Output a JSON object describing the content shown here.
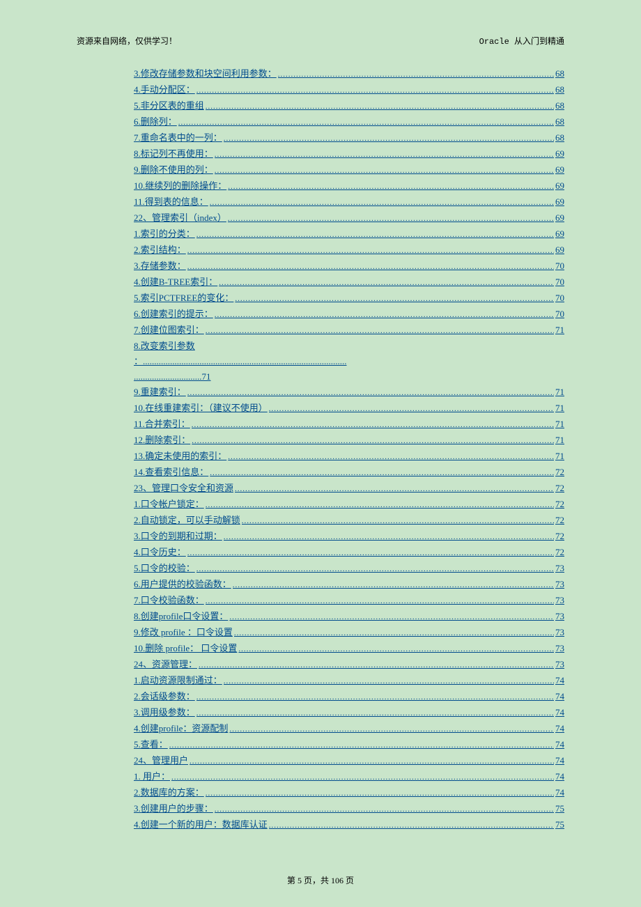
{
  "header": {
    "left": "资源来自网络，仅供学习！",
    "right": "Oracle 从入门到精通"
  },
  "toc": [
    {
      "label": "3.修改存储参数和块空间利用参数：",
      "page": "68"
    },
    {
      "label": "4.手动分配区：",
      "page": "68"
    },
    {
      "label": "5.非分区表的重组",
      "page": "68"
    },
    {
      "label": "6.删除列：",
      "page": "68"
    },
    {
      "label": "7.重命名表中的一列：",
      "page": "68"
    },
    {
      "label": "8.标记列不再使用：",
      "page": "69"
    },
    {
      "label": "9.删除不使用的列：",
      "page": "69"
    },
    {
      "label": "10.继续列的删除操作：",
      "page": "69"
    },
    {
      "label": "11.得到表的信息：",
      "page": "69"
    },
    {
      "label": "22、管理索引（index）",
      "page": "69",
      "section": true
    },
    {
      "label": "1.索引的分类：",
      "page": "69"
    },
    {
      "label": "2.索引结构：",
      "page": "69"
    },
    {
      "label": "3.存储参数：",
      "page": "70"
    },
    {
      "label": "4.创建B-TREE索引：",
      "page": "70"
    },
    {
      "label": "5.索引PCTFREE的变化：",
      "page": "70"
    },
    {
      "label": "6.创建索引的提示：",
      "page": "70"
    },
    {
      "label": "7.创建位图索引：",
      "page": "71"
    },
    {
      "label": "8.改变索引参数",
      "page": "71",
      "multiline": true
    },
    {
      "label": "9.重建索引：",
      "page": "71"
    },
    {
      "label": "10.在线重建索引：（建议不使用）",
      "page": "71"
    },
    {
      "label": "11.合并索引：",
      "page": "71"
    },
    {
      "label": "12.删除索引：",
      "page": "71"
    },
    {
      "label": "13.确定未使用的索引：",
      "page": "71"
    },
    {
      "label": "14.查看索引信息：",
      "page": "72"
    },
    {
      "label": "23、管理口令安全和资源",
      "page": "72",
      "section": true
    },
    {
      "label": "1.口令帐户锁定：",
      "page": "72"
    },
    {
      "label": "2.自动锁定，可以手动解锁",
      "page": "72"
    },
    {
      "label": "3.口令的到期和过期：",
      "page": "72"
    },
    {
      "label": "4.口令历史：",
      "page": "72"
    },
    {
      "label": "5.口令的校验：",
      "page": "73"
    },
    {
      "label": "6.用户提供的校验函数：",
      "page": "73"
    },
    {
      "label": "7.口令校验函数：",
      "page": "73"
    },
    {
      "label": "8.创建profile口令设置：",
      "page": "73"
    },
    {
      "label": "9.修改 profile ：口令设置",
      "page": "73"
    },
    {
      "label": "10.删除 profile： 口令设置",
      "page": "73"
    },
    {
      "label": "24、资源管理：",
      "page": "73",
      "section": true
    },
    {
      "label": "1.启动资源限制通过：",
      "page": "74"
    },
    {
      "label": "2.会话级参数：",
      "page": "74"
    },
    {
      "label": "3.调用级参数：",
      "page": "74"
    },
    {
      "label": "4.创建profile：资源配制",
      "page": "74"
    },
    {
      "label": "5.查看：",
      "page": "74"
    },
    {
      "label": "24、管理用户",
      "page": "74",
      "section": true
    },
    {
      "label": "1.    用户：",
      "page": "74"
    },
    {
      "label": "2.数据库的方案：",
      "page": "74"
    },
    {
      "label": "3.创建用户的步骤：",
      "page": "75"
    },
    {
      "label": "4.创建一个新的用户：数据库认证",
      "page": "75"
    }
  ],
  "footer": {
    "text": "第 5 页，共 106 页"
  }
}
